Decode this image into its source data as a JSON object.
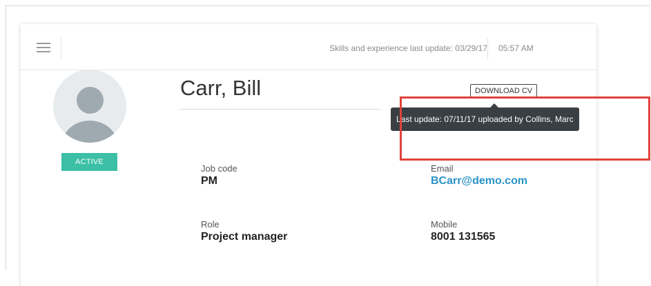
{
  "header": {
    "skills_update": "Skills and experience last update: 03/29/17",
    "time": "05:57 AM"
  },
  "profile": {
    "name": "Carr, Bill",
    "status": "ACTIVE",
    "download_label": "DOWNLOAD CV",
    "tooltip": "Last update: 07/11/17 uploaded by Collins, Marc"
  },
  "fields": {
    "job_code": {
      "label": "Job code",
      "value": "PM"
    },
    "email": {
      "label": "Email",
      "value": "BCarr@demo.com"
    },
    "role": {
      "label": "Role",
      "value": "Project manager"
    },
    "mobile": {
      "label": "Mobile",
      "value": "8001 131565"
    }
  },
  "colors": {
    "status_badge": "#3bbfa5",
    "link": "#2a93c9",
    "highlight": "#e0423a",
    "tooltip_bg": "#3a3f44"
  },
  "icons": {
    "menu": "hamburger-icon",
    "avatar": "user-placeholder-icon"
  }
}
